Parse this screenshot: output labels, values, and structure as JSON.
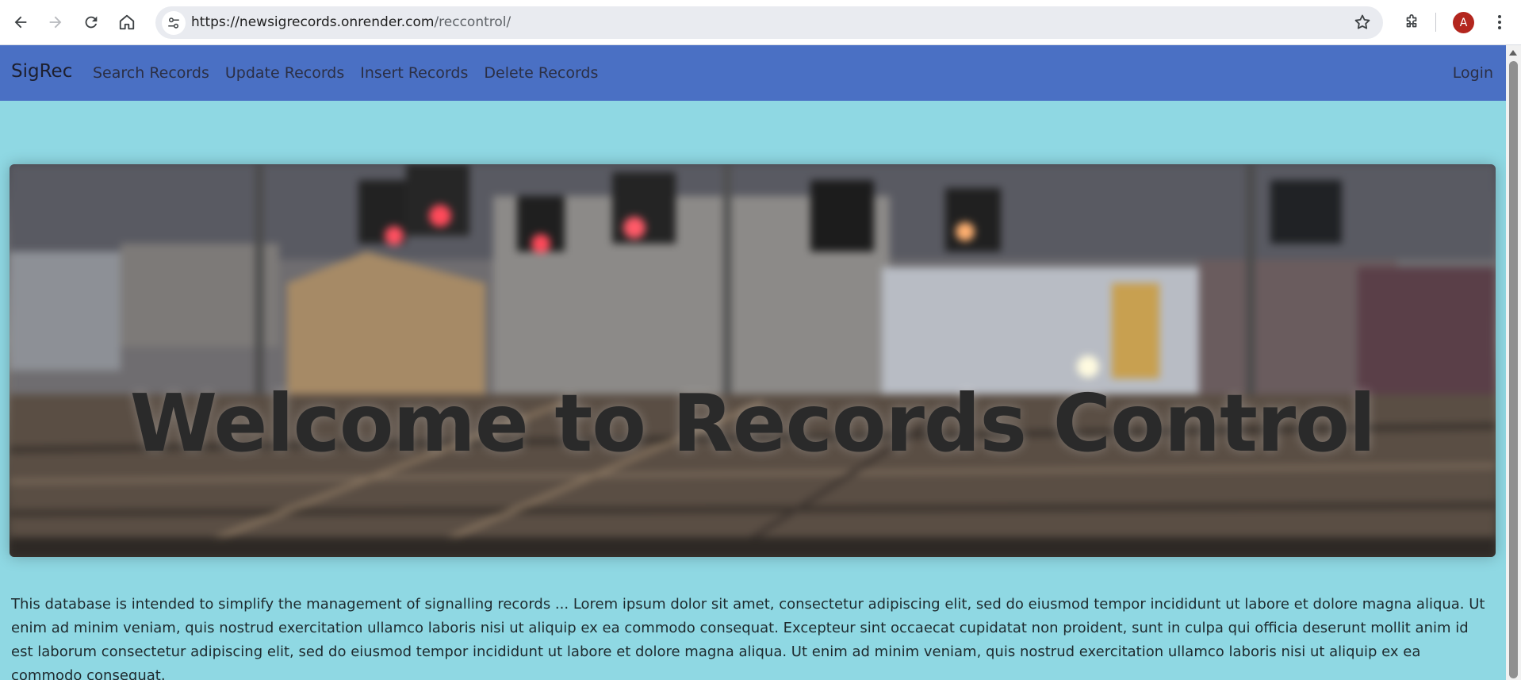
{
  "browser": {
    "url_host": "https://newsigrecords.onrender.com",
    "url_path": "/reccontrol/",
    "profile_initial": "A"
  },
  "navbar": {
    "brand": "SigRec",
    "links": [
      "Search Records",
      "Update Records",
      "Insert Records",
      "Delete Records"
    ],
    "login": "Login"
  },
  "hero": {
    "title": "Welcome to Records Control",
    "image_alt_icon": "railway-signals-image"
  },
  "intro": {
    "text": "This database is intended to simplify the management of signalling records ... Lorem ipsum dolor sit amet, consectetur adipiscing elit, sed do eiusmod tempor incididunt ut labore et dolore magna aliqua. Ut enim ad minim veniam, quis nostrud exercitation ullamco laboris nisi ut aliquip ex ea commodo consequat. Excepteur sint occaecat cupidatat non proident, sunt in culpa qui officia deserunt mollit anim id est laborum consectetur adipiscing elit, sed do eiusmod tempor incididunt ut labore et dolore magna aliqua. Ut enim ad minim veniam, quis nostrud exercitation ullamco laboris nisi ut aliquip ex ea commodo consequat."
  },
  "colors": {
    "navbar": "#4a70c4",
    "page_background": "#8fd8e3",
    "avatar": "#b3261e"
  }
}
